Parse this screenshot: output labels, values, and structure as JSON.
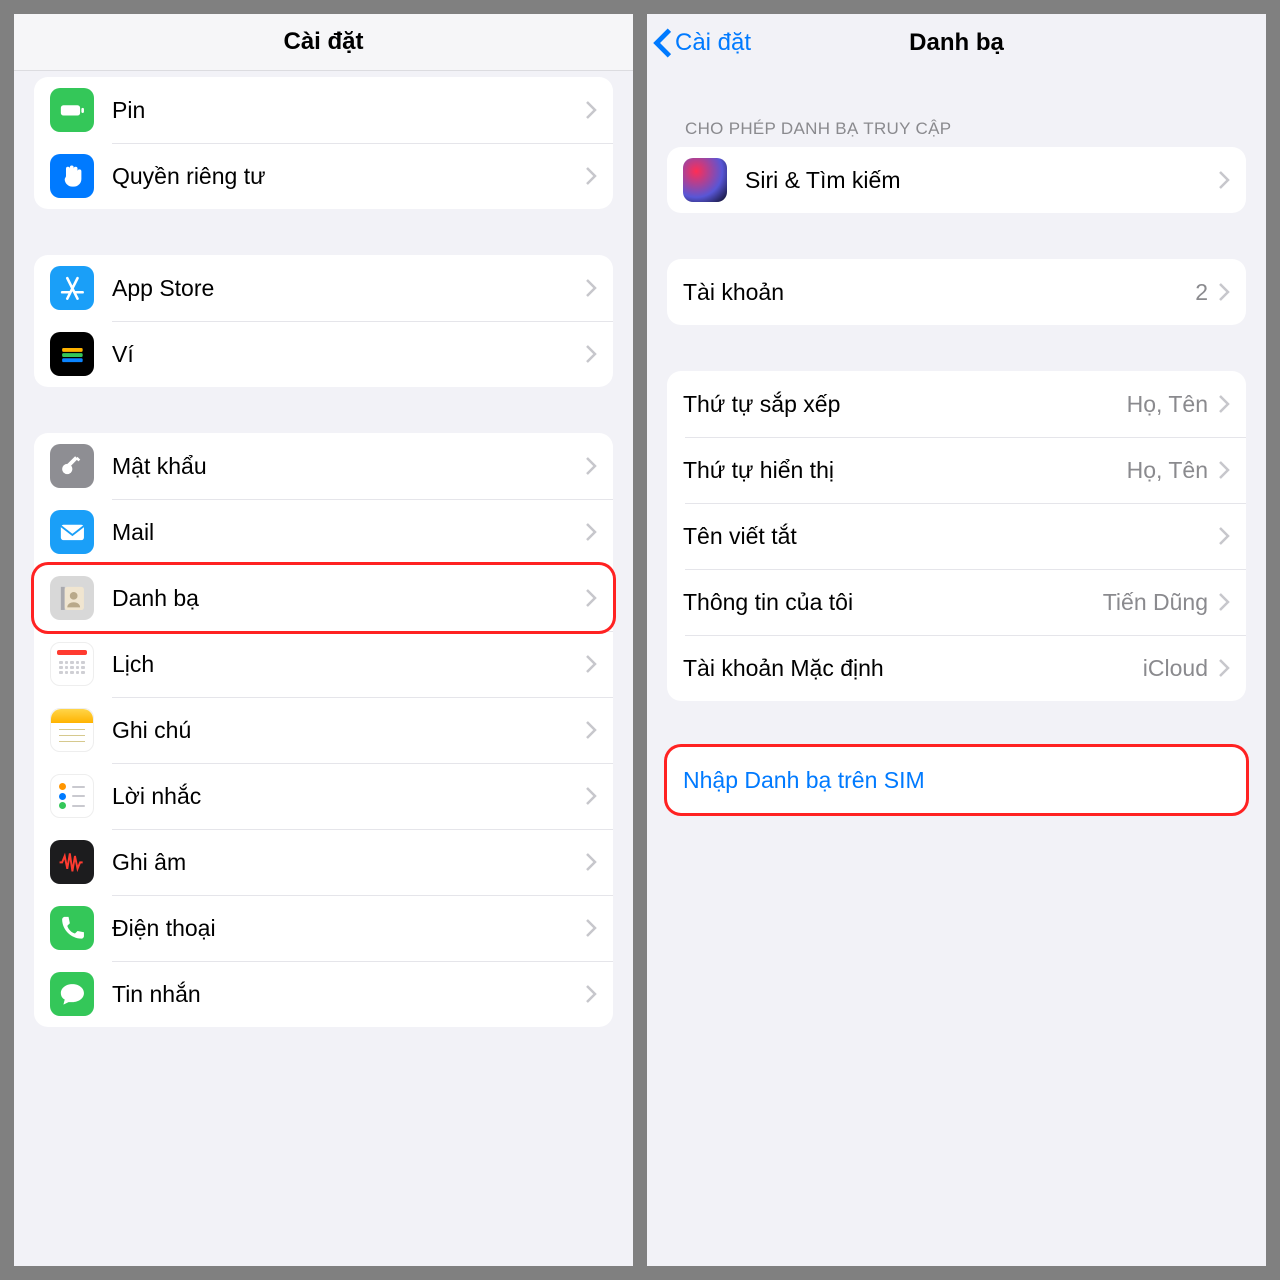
{
  "left": {
    "title": "Cài đặt",
    "groups": [
      {
        "items": [
          {
            "key": "battery",
            "label": "Pin"
          },
          {
            "key": "privacy",
            "label": "Quyền riêng tư"
          }
        ]
      },
      {
        "items": [
          {
            "key": "appstore",
            "label": "App Store"
          },
          {
            "key": "wallet",
            "label": "Ví"
          }
        ]
      },
      {
        "items": [
          {
            "key": "passwords",
            "label": "Mật khẩu"
          },
          {
            "key": "mail",
            "label": "Mail"
          },
          {
            "key": "contacts",
            "label": "Danh bạ",
            "highlight": true
          },
          {
            "key": "calendar",
            "label": "Lịch"
          },
          {
            "key": "notes",
            "label": "Ghi chú"
          },
          {
            "key": "reminders",
            "label": "Lời nhắc"
          },
          {
            "key": "voice",
            "label": "Ghi âm"
          },
          {
            "key": "phone",
            "label": "Điện thoại"
          },
          {
            "key": "messages",
            "label": "Tin nhắn"
          }
        ]
      }
    ]
  },
  "right": {
    "back": "Cài đặt",
    "title": "Danh bạ",
    "section_header": "CHO PHÉP DANH BẠ TRUY CẬP",
    "siri_label": "Siri & Tìm kiếm",
    "accounts_label": "Tài khoản",
    "accounts_value": "2",
    "sort_label": "Thứ tự sắp xếp",
    "sort_value": "Họ, Tên",
    "display_label": "Thứ tự hiển thị",
    "display_value": "Họ, Tên",
    "short_label": "Tên viết tắt",
    "myinfo_label": "Thông tin của tôi",
    "myinfo_value": "Tiến Dũng",
    "default_label": "Tài khoản Mặc định",
    "default_value": "iCloud",
    "import_label": "Nhập Danh bạ trên SIM"
  }
}
